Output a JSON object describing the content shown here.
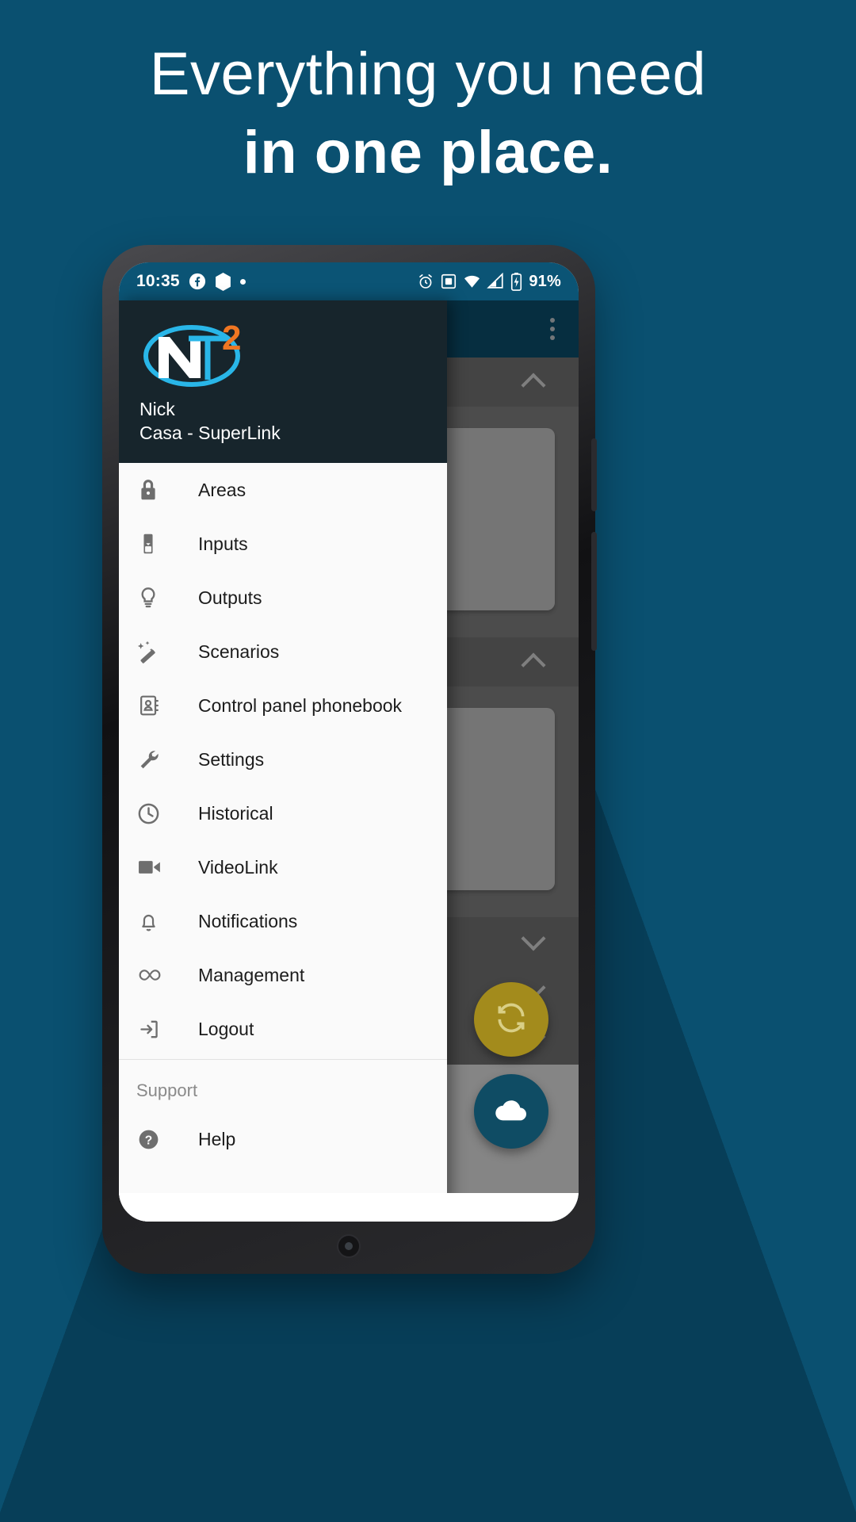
{
  "promo": {
    "headline_line1": "Everything you need",
    "headline_line2": "in one place.",
    "background_color": "#0a5070",
    "wedge_color": "#073e57"
  },
  "status_bar": {
    "time": "10:35",
    "left_icons": [
      "facebook-icon",
      "hexagon-icon",
      "dot-icon"
    ],
    "right_icons": [
      "alarm-icon",
      "screen-record-icon",
      "wifi-icon",
      "signal-icon",
      "battery-charging-icon"
    ],
    "battery_percent": "91%",
    "background_color": "#0b5475"
  },
  "app_bar": {
    "overflow_menu": "more-options",
    "background_color": "#0b5475"
  },
  "drawer": {
    "header": {
      "logo_text": "NT",
      "logo_superscript": "2",
      "logo_accent_color": "#29b6e8",
      "logo_superscript_color": "#ef7622",
      "user_name": "Nick",
      "user_site": "Casa - SuperLink",
      "background_color": "#17252c"
    },
    "items": [
      {
        "label": "Areas",
        "icon": "lock-icon"
      },
      {
        "label": "Inputs",
        "icon": "sensor-icon"
      },
      {
        "label": "Outputs",
        "icon": "lightbulb-icon"
      },
      {
        "label": "Scenarios",
        "icon": "magic-wand-icon"
      },
      {
        "label": "Control panel phonebook",
        "icon": "contacts-icon"
      },
      {
        "label": "Settings",
        "icon": "wrench-icon"
      },
      {
        "label": "Historical",
        "icon": "clock-icon"
      },
      {
        "label": "VideoLink",
        "icon": "videocam-icon"
      },
      {
        "label": "Notifications",
        "icon": "bell-icon"
      },
      {
        "label": "Management",
        "icon": "infinity-icon"
      },
      {
        "label": "Logout",
        "icon": "logout-icon"
      }
    ],
    "support": {
      "section_title": "Support",
      "items": [
        {
          "label": "Help",
          "icon": "help-circle-icon"
        }
      ]
    }
  },
  "app_content": {
    "groups": [
      {
        "state": "expanded",
        "chevron": "chevron-up-icon",
        "has_lock_card": true
      },
      {
        "state": "expanded",
        "chevron": "chevron-up-icon",
        "has_lock_card": true
      },
      {
        "state": "collapsed",
        "chevron": "chevron-down-icon",
        "has_lock_card": false
      },
      {
        "state": "collapsed",
        "chevron": "chevron-down-icon",
        "has_lock_card": false
      },
      {
        "state": "collapsed",
        "chevron": "chevron-down-icon",
        "has_lock_card": false
      }
    ],
    "card_icon": "lock-icon",
    "fabs": [
      {
        "name": "sync-fab",
        "icon": "sync-icon",
        "color": "#a38b1c"
      },
      {
        "name": "cloud-fab",
        "icon": "cloud-icon",
        "color": "#0f4c64"
      }
    ]
  }
}
